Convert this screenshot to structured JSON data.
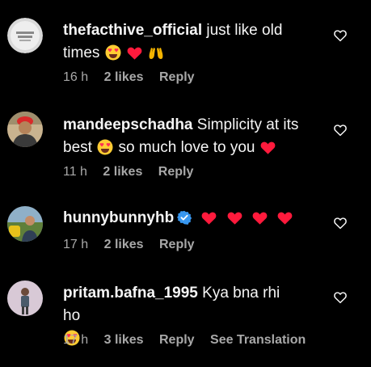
{
  "comments": [
    {
      "username": "thefacthive_official",
      "text": "just like old times",
      "emojis": [
        "heart-eyes-emoji",
        "red-heart-emoji",
        "raising-hands-emoji"
      ],
      "time": "16 h",
      "likes": "2 likes",
      "reply": "Reply"
    },
    {
      "username": "mandeepschadha",
      "text_before": "Simplicity at its best",
      "text_after": "so much love to you",
      "emojis": [
        "heart-eyes-emoji",
        "red-heart-emoji"
      ],
      "time": "11 h",
      "likes": "2 likes",
      "reply": "Reply"
    },
    {
      "username": "hunnybunnyhb",
      "verified": true,
      "emojis": [
        "red-heart-emoji",
        "red-heart-emoji",
        "red-heart-emoji",
        "red-heart-emoji"
      ],
      "time": "17 h",
      "likes": "2 likes",
      "reply": "Reply"
    },
    {
      "username": "pritam.bafna_1995",
      "text": "Kya bna rhi ho",
      "emojis": [
        "heart-eyes-emoji"
      ],
      "time": "17 h",
      "likes": "3 likes",
      "reply": "Reply",
      "translate": "See Translation"
    }
  ],
  "colors": {
    "background": "#000000",
    "text": "#f5f5f5",
    "meta": "#a8a8a8",
    "heart_emoji": "#ff1a3c",
    "verified": "#3897f0"
  }
}
